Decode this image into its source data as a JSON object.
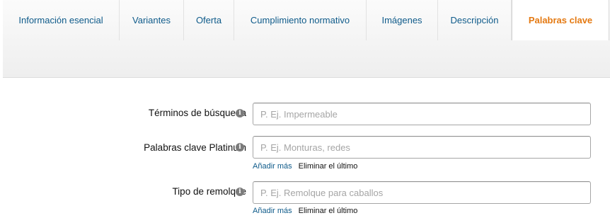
{
  "tabs": [
    {
      "label": "Información esencial",
      "active": false
    },
    {
      "label": "Variantes",
      "active": false
    },
    {
      "label": "Oferta",
      "active": false
    },
    {
      "label": "Cumplimiento normativo",
      "active": false
    },
    {
      "label": "Imágenes",
      "active": false
    },
    {
      "label": "Descripción",
      "active": false
    },
    {
      "label": "Palabras clave",
      "active": true
    }
  ],
  "form": {
    "search_terms": {
      "label": "Términos de búsqueda",
      "value": "",
      "placeholder": "P. Ej. Impermeable"
    },
    "platinum_keywords": {
      "label": "Palabras clave Platinum",
      "value": "",
      "placeholder": "P. Ej. Monturas, redes",
      "add_more": "Añadir más",
      "remove_last": "Eliminar el último"
    },
    "trailer_type": {
      "label": "Tipo de remolque",
      "value": "",
      "placeholder": "P. Ej. Remolque para caballos",
      "add_more": "Añadir más",
      "remove_last": "Eliminar el último"
    }
  },
  "colors": {
    "tab_link": "#0f5b8a",
    "tab_active": "#e47911",
    "text": "#111111",
    "placeholder": "#a5a5a5"
  },
  "icons": {
    "info": "info-icon"
  }
}
